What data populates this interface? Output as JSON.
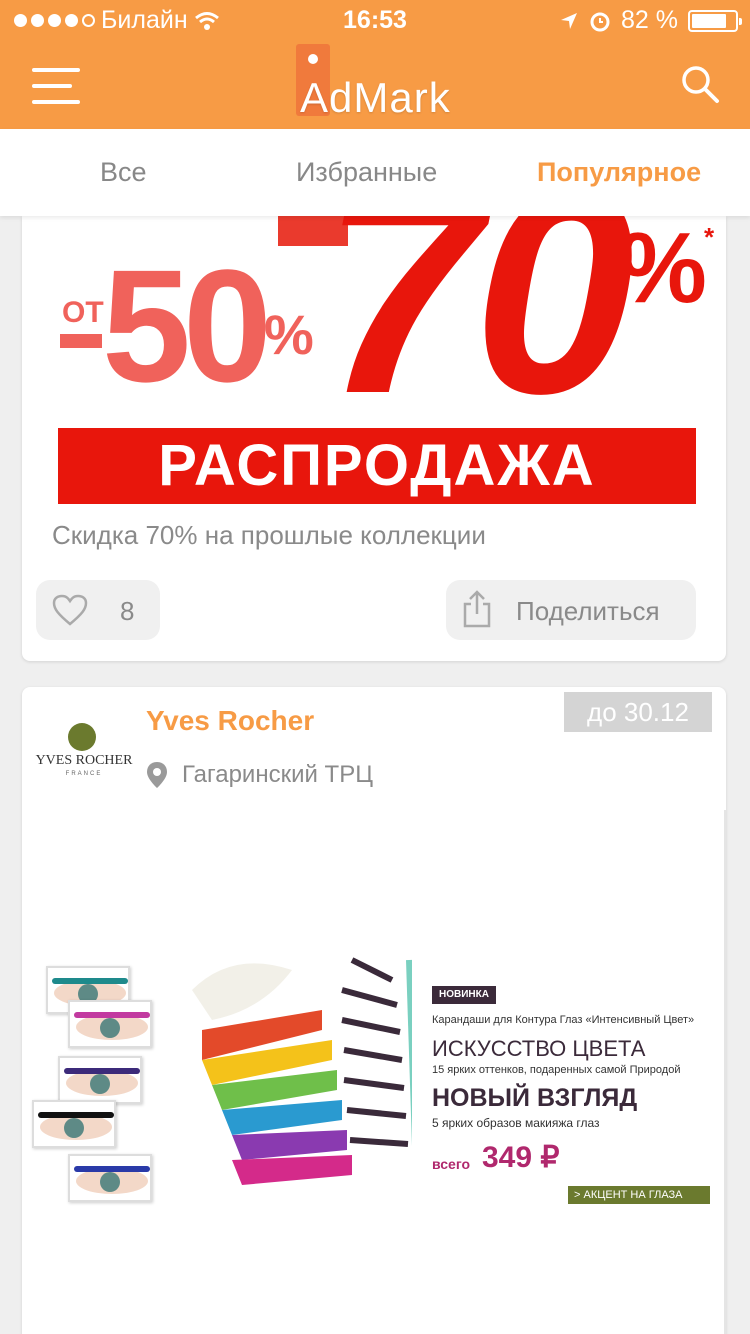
{
  "status_bar": {
    "carrier": "Билайн",
    "time": "16:53",
    "battery": "82 %",
    "battery_level": 0.82,
    "signal_bars": 4
  },
  "header": {
    "logo_text": "AdMark",
    "accent_color": "#f79b45"
  },
  "tabs": [
    {
      "label": "Все",
      "active": false
    },
    {
      "label": "Избранные",
      "active": false
    },
    {
      "label": "Популярное",
      "active": true
    }
  ],
  "posts": [
    {
      "image": {
        "from_label": "ОТ",
        "small_value": "50",
        "small_percent": "%",
        "big_value": "70",
        "big_percent": "%",
        "asterisk": "*",
        "banner": "РАСПРОДАЖА"
      },
      "caption": "Скидка 70% на прошлые коллекции",
      "likes": "8",
      "share_label": "Поделиться"
    },
    {
      "brand": "Yves Rocher",
      "brand_logo_text": "YVES ROCHER",
      "brand_logo_sub": "FRANCE",
      "location": "Гагаринский ТРЦ",
      "valid_until": "до 30.12",
      "ad": {
        "badge": "НОВИНКА",
        "line1": "Карандаши для Контура Глаз «Интенсивный Цвет»",
        "line2": "ИСКУССТВО ЦВЕТА",
        "line3": "15 ярких оттенков, подаренных самой Природой",
        "line4": "НОВЫЙ ВЗГЛЯД",
        "line5": "5 ярких образов макияжа глаз",
        "price_label": "всего",
        "price": "349 ₽",
        "cta": "> АКЦЕНТ НА ГЛАЗА"
      }
    }
  ]
}
